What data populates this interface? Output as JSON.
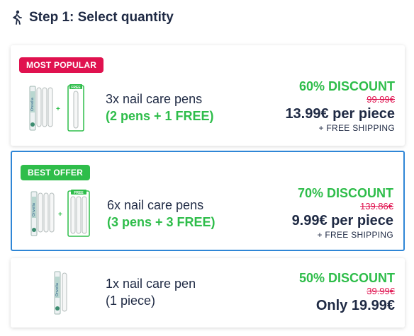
{
  "step": {
    "title": "Step 1: Select quantity",
    "icon": "walking-person-icon"
  },
  "colors": {
    "accent_green": "#2ebd4a",
    "accent_red": "#e0124f",
    "selected_border": "#2f86d6",
    "text_dark": "#1f2a44"
  },
  "options": [
    {
      "badge": "MOST POPULAR",
      "title": "3x nail care pens",
      "subtitle": "(2 pens + 1 FREE)",
      "discount": "60% DISCOUNT",
      "old_price": "99.99€",
      "new_price": "13.99€ per piece",
      "shipping": "+ FREE SHIPPING",
      "brand": "Onvelia",
      "free_label": "FREE",
      "plus": "+"
    },
    {
      "badge": "BEST OFFER",
      "title": "6x nail care pens",
      "subtitle": "(3 pens + 3 FREE)",
      "discount": "70% DISCOUNT",
      "old_price": "139.86€",
      "new_price": "9.99€ per piece",
      "shipping": "+ FREE SHIPPING",
      "brand": "Onvelia",
      "free_label": "FREE",
      "plus": "+",
      "selected": true
    },
    {
      "title": "1x nail care pen",
      "subtitle": "(1 piece)",
      "discount": "50% DISCOUNT",
      "old_price": "39.99€",
      "new_price": "Only 19.99€",
      "brand": "Onvelia"
    }
  ]
}
